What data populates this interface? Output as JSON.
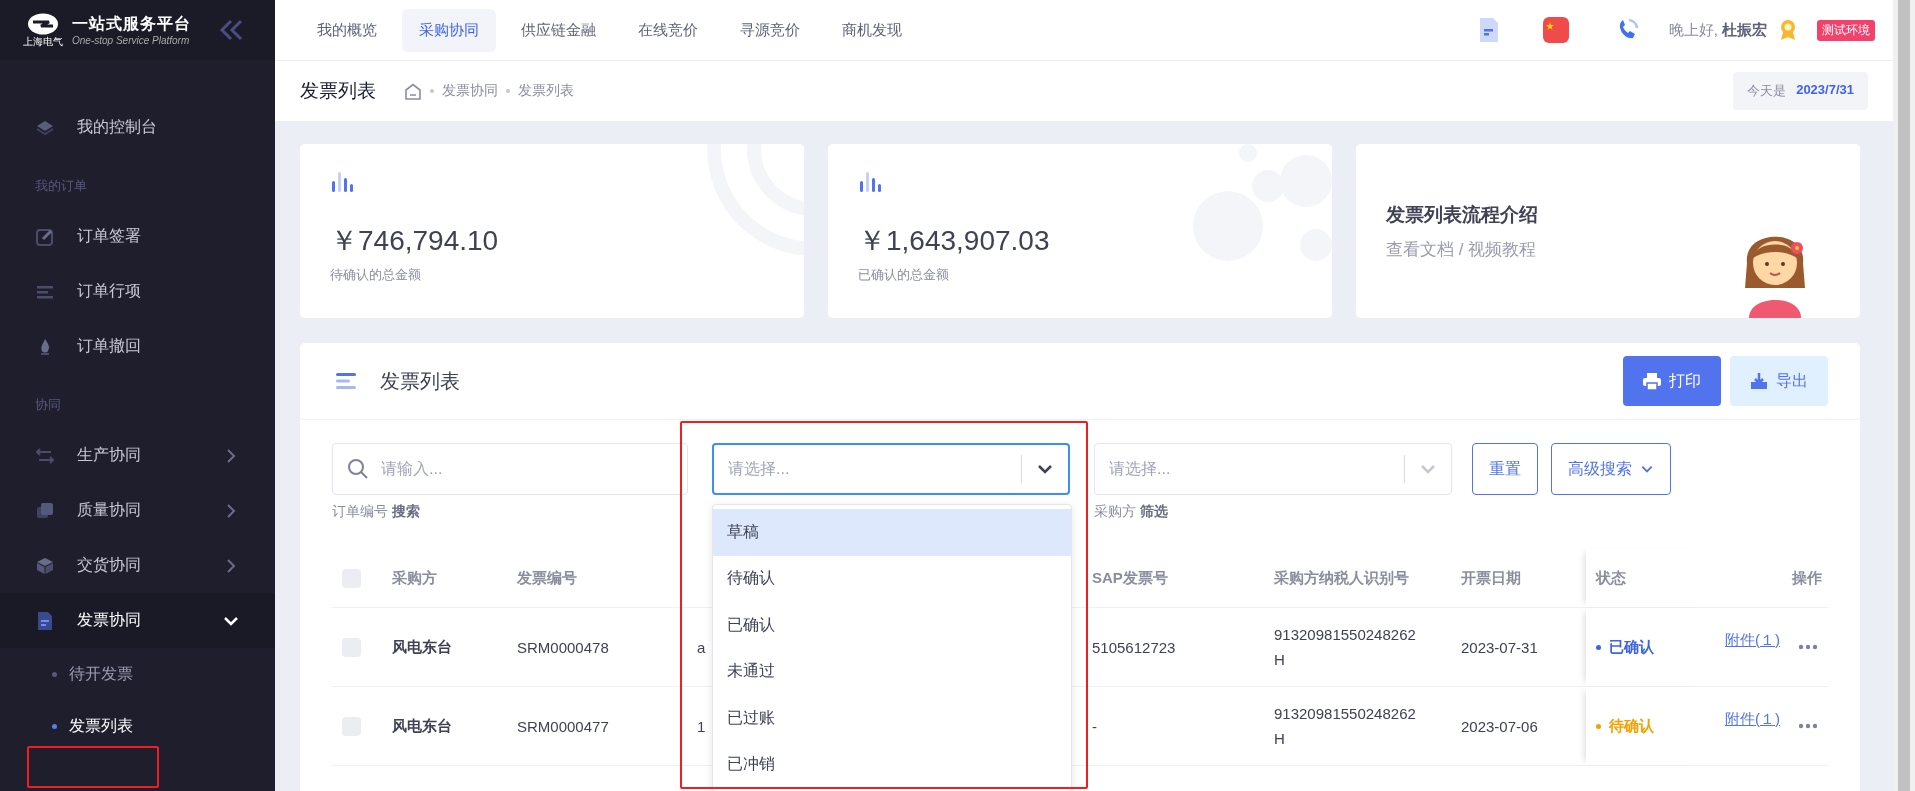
{
  "sidebar": {
    "brand_mark": "上海电气",
    "title": "一站式服务平台",
    "subtitle": "One-stop Service Platform",
    "entries": [
      {
        "kind": "item",
        "label": "我的控制台"
      },
      {
        "kind": "section",
        "label": "我的订单"
      },
      {
        "kind": "item",
        "label": "订单签署"
      },
      {
        "kind": "item",
        "label": "订单行项"
      },
      {
        "kind": "item",
        "label": "订单撤回"
      },
      {
        "kind": "section",
        "label": "协同"
      },
      {
        "kind": "group",
        "label": "生产协同",
        "expanded": false
      },
      {
        "kind": "group",
        "label": "质量协同",
        "expanded": false
      },
      {
        "kind": "group",
        "label": "交货协同",
        "expanded": false
      },
      {
        "kind": "group",
        "label": "发票协同",
        "expanded": true,
        "children": [
          {
            "label": "待开发票",
            "selected": false
          },
          {
            "label": "发票列表",
            "selected": true
          }
        ]
      }
    ]
  },
  "top_nav": {
    "tabs": [
      {
        "label": "我的概览",
        "selected": false
      },
      {
        "label": "采购协同",
        "selected": true
      },
      {
        "label": "供应链金融",
        "selected": false
      },
      {
        "label": "在线竞价",
        "selected": false
      },
      {
        "label": "寻源竞价",
        "selected": false
      },
      {
        "label": "商机发现",
        "selected": false
      }
    ],
    "greeting": "晚上好, **杜振宏**",
    "env_badge": "测试环境"
  },
  "page_header": {
    "title": "发票列表",
    "breadcrumb": [
      "发票协同",
      "发票列表"
    ],
    "date_label": "今天是",
    "date": "2023/7/31"
  },
  "stats": [
    {
      "amount": "￥746,794.10",
      "label": "待确认的总金额"
    },
    {
      "amount": "￥1,643,907.03",
      "label": "已确认的总金额"
    }
  ],
  "guide": {
    "title": "发票列表流程介绍",
    "link": "查看文档 / 视频教程"
  },
  "panel": {
    "title": "发票列表",
    "buttons": [
      {
        "kind": "primary",
        "label": "打印"
      },
      {
        "kind": "secondary",
        "label": "导出"
      }
    ],
    "search": {
      "placeholder": "请输入...",
      "hint": "订单编号 **搜索**"
    },
    "status_select": {
      "placeholder": "请选择...",
      "focused": true,
      "expanded": true,
      "options": [
        {
          "label": "草稿",
          "selected": true
        },
        {
          "label": "待确认",
          "selected": false
        },
        {
          "label": "已确认",
          "selected": false
        },
        {
          "label": "未通过",
          "selected": false
        },
        {
          "label": "已过账",
          "selected": false
        },
        {
          "label": "已冲销",
          "selected": false
        }
      ]
    },
    "buyer_select": {
      "placeholder": "请选择...",
      "focused": false,
      "hint": "采购方 **筛选**"
    },
    "actions": [
      {
        "kind": "plain",
        "label": "重置"
      },
      {
        "kind": "dropdown",
        "label": "高级搜索"
      }
    ]
  },
  "table": {
    "header_checked": false,
    "columns": [
      {
        "label": "采购方"
      },
      {
        "label": "发票编号"
      },
      {},
      {
        "label": "SAP发票号"
      },
      {
        "label": "采购方纳税人识别号"
      },
      {
        "label": "开票日期"
      },
      {
        "label": "状态"
      },
      {
        "label": "操作"
      }
    ],
    "rows": [
      {
        "checked": false,
        "buyer": "风电东台",
        "invoice_no": "SRM0000478",
        "column_3": "a",
        "sap_no": "5105612723",
        "tax_id": "91320981550248262H",
        "date": "2023-07-31",
        "status": "已确认",
        "color": "#3d63e8",
        "attachment": "附件(１)"
      },
      {
        "checked": false,
        "buyer": "风电东台",
        "invoice_no": "SRM0000477",
        "column_3": "1",
        "sap_no": "-",
        "tax_id": "91320981550248262H",
        "date": "2023-07-06",
        "status": "待确认",
        "color": "#f5a000",
        "attachment": "附件(１)"
      }
    ]
  }
}
